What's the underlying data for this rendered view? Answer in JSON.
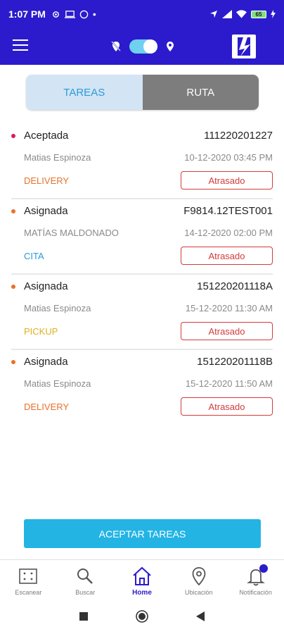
{
  "status_bar": {
    "time": "1:07 PM",
    "battery_level": "65"
  },
  "tabs": [
    {
      "label": "TAREAS",
      "active": true
    },
    {
      "label": "RUTA",
      "active": false
    }
  ],
  "tasks": [
    {
      "status": "Aceptada",
      "code": "111220201227",
      "person": "Matias Espinoza",
      "date": "10-12-2020 03:45 PM",
      "type": "DELIVERY",
      "type_color": "#e8712a",
      "dot_color": "#d81b60",
      "badge": "Atrasado"
    },
    {
      "status": "Asignada",
      "code": "F9814.12TEST001",
      "person": "MATÍAS MALDONADO",
      "date": "14-12-2020 02:00 PM",
      "type": "CITA",
      "type_color": "#2a9bd6",
      "dot_color": "#e8712a",
      "badge": "Atrasado"
    },
    {
      "status": "Asignada",
      "code": "151220201118A",
      "person": "Matias Espinoza",
      "date": "15-12-2020 11:30 AM",
      "type": "PICKUP",
      "type_color": "#e0b020",
      "dot_color": "#e8712a",
      "badge": "Atrasado"
    },
    {
      "status": "Asignada",
      "code": "151220201118B",
      "person": "Matias Espinoza",
      "date": "15-12-2020 11:50 AM",
      "type": "DELIVERY",
      "type_color": "#e8712a",
      "dot_color": "#e8712a",
      "badge": "Atrasado"
    }
  ],
  "accept_button": "ACEPTAR TAREAS",
  "bottom_nav": [
    {
      "label": "Escanear",
      "icon": "scan-icon",
      "active": false
    },
    {
      "label": "Buscar",
      "icon": "search-icon",
      "active": false
    },
    {
      "label": "Home",
      "icon": "home-icon",
      "active": true
    },
    {
      "label": "Ubicación",
      "icon": "location-icon",
      "active": false
    },
    {
      "label": "Notificación",
      "icon": "bell-icon",
      "active": false
    }
  ],
  "colors": {
    "primary": "#2b1bcc",
    "accent": "#23b4e4",
    "late": "#d43b3b"
  }
}
